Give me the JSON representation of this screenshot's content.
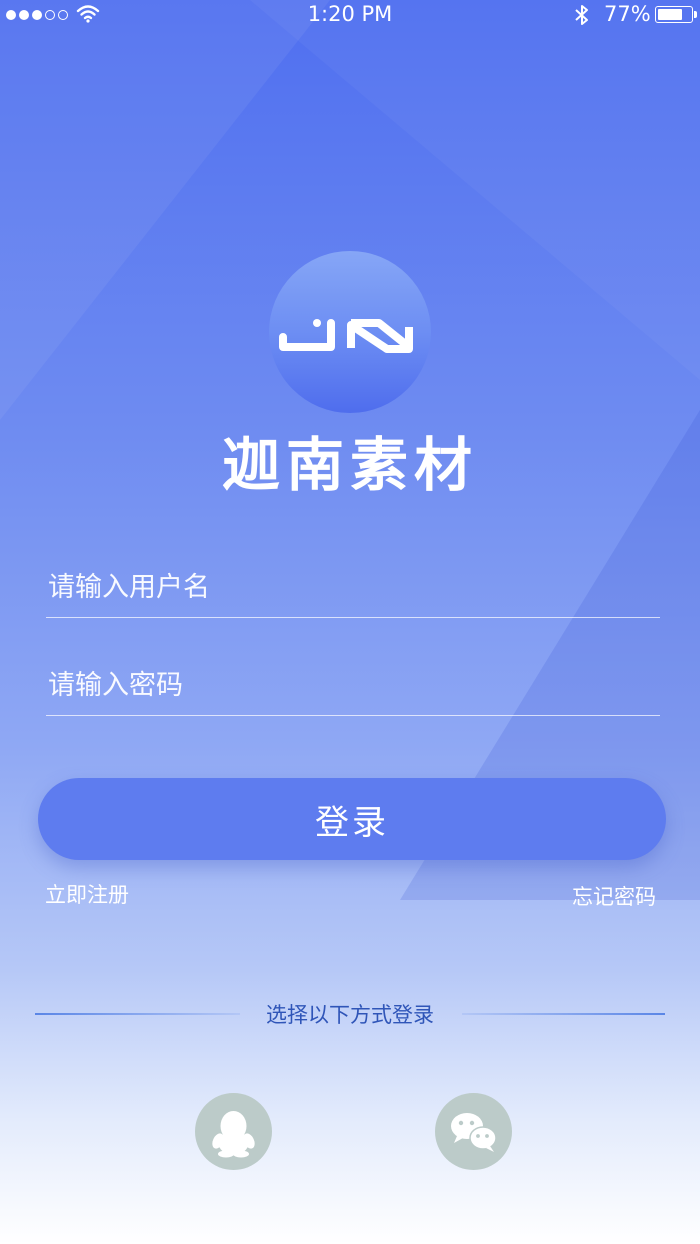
{
  "status_bar": {
    "signal_icon": "signal-dots-icon",
    "wifi_icon": "wifi-icon",
    "time": "1:20 PM",
    "bluetooth_icon": "bluetooth-icon",
    "battery_percent": "77%",
    "battery_level": 0.77
  },
  "brand": {
    "logo_text": "JN",
    "name": "迦南素材",
    "logo_colors": [
      "#86a6f6",
      "#4f6ded"
    ]
  },
  "form": {
    "username_placeholder": "请输入用户名",
    "username_value": "",
    "password_placeholder": "请输入密码",
    "password_value": "",
    "login_label": "登录",
    "register_label": "立即注册",
    "forgot_label": "忘记密码"
  },
  "social": {
    "divider_text": "选择以下方式登录",
    "providers": [
      {
        "name": "qq",
        "icon": "qq-penguin-icon"
      },
      {
        "name": "wechat",
        "icon": "wechat-icon"
      }
    ]
  },
  "colors": {
    "accent": "#5e7cef",
    "social_bg": "#bccbc9",
    "divider_text": "#2f55b8"
  }
}
